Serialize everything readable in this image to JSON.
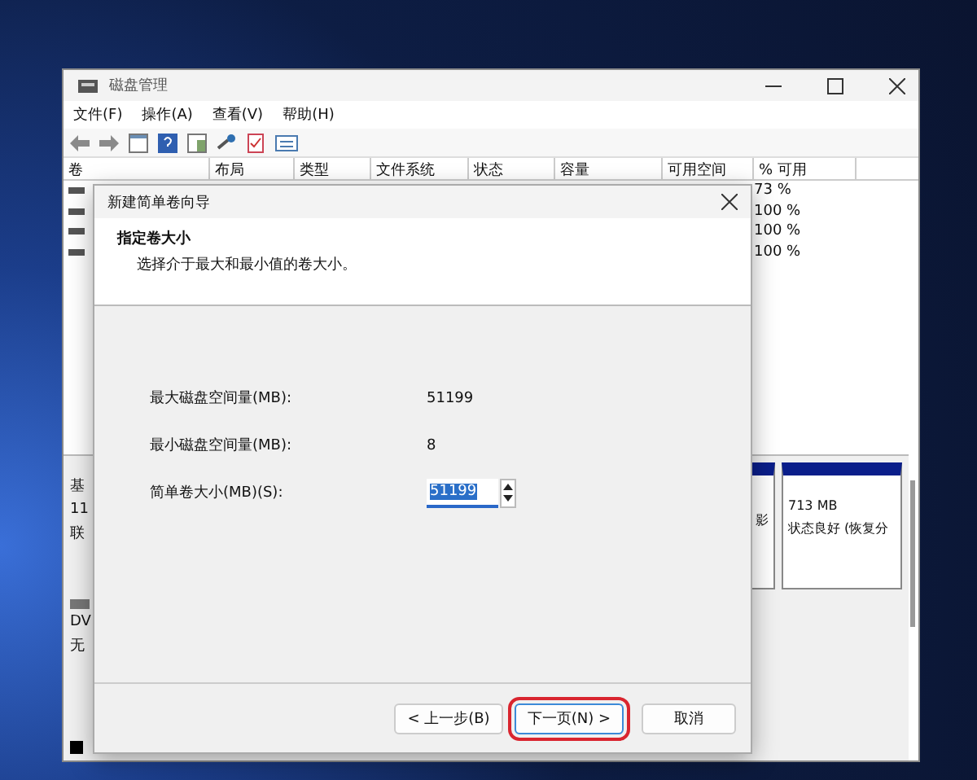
{
  "main_window": {
    "title": "磁盘管理",
    "menu": [
      "文件(F)",
      "操作(A)",
      "查看(V)",
      "帮助(H)"
    ],
    "columns": [
      "卷",
      "布局",
      "类型",
      "文件系统",
      "状态",
      "容量",
      "可用空间",
      "% 可用"
    ],
    "rows": [
      {
        "percent_free": "73 %"
      },
      {
        "percent_free": "100 %"
      },
      {
        "percent_free": "100 %"
      },
      {
        "percent_free": "100 %"
      }
    ],
    "disk_labels": [
      "基",
      "11",
      "联"
    ],
    "cdrom_labels": [
      "DV",
      "无"
    ],
    "partition_fragment": "影",
    "partition": {
      "size": "713 MB",
      "status": "状态良好 (恢复分"
    }
  },
  "dialog": {
    "title": "新建简单卷向导",
    "heading": "指定卷大小",
    "subtitle": "选择介于最大和最小值的卷大小。",
    "fields": [
      {
        "kind": "readonly",
        "label": "最大磁盘空间量(MB):",
        "value": "51199"
      },
      {
        "kind": "readonly",
        "label": "最小磁盘空间量(MB):",
        "value": "8"
      },
      {
        "kind": "spinner",
        "label": "简单卷大小(MB)(S):",
        "value": "51199"
      }
    ],
    "buttons": [
      {
        "label": "< 上一步(B)",
        "highlighted": false
      },
      {
        "label": "下一页(N) >",
        "highlighted": true
      },
      {
        "label": "取消",
        "highlighted": false
      }
    ]
  }
}
